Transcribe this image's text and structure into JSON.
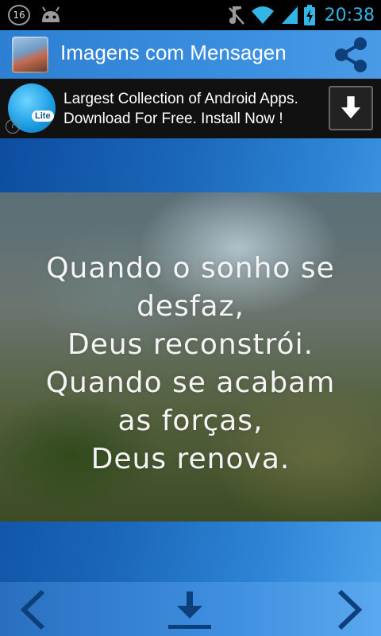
{
  "status_bar": {
    "notification_count": "16",
    "time": "20:38"
  },
  "action_bar": {
    "title": "Imagens com Mensagen",
    "app_icon": "app-icon",
    "share_icon": "share-icon"
  },
  "ad_banner": {
    "logo_badge": "Lite",
    "line1": "Largest Collection of Android Apps.",
    "line2": "Download For Free. Install Now !",
    "info_glyph": "i",
    "download_icon": "download-arrow-icon"
  },
  "quote": {
    "lines": [
      "Quando o sonho se",
      "desfaz,",
      "Deus reconstrói.",
      "Quando se acabam",
      "as forças,",
      "Deus renova."
    ]
  },
  "bottom_bar": {
    "prev_icon": "chevron-left-icon",
    "download_icon": "download-icon",
    "next_icon": "chevron-right-icon"
  },
  "colors": {
    "accent": "#33b5e5",
    "action_bar": "#3a8ee0",
    "ad_background": "#111111"
  }
}
